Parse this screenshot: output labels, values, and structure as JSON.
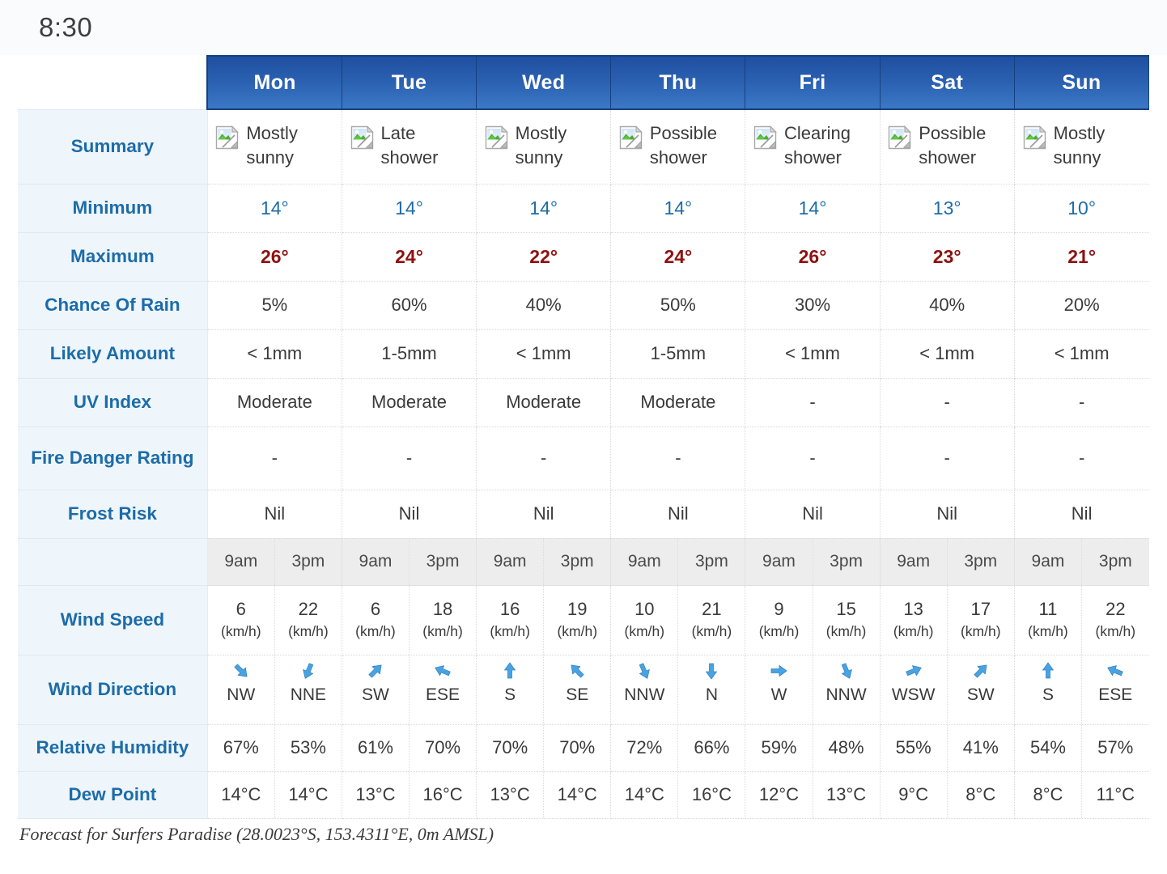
{
  "status_bar": {
    "clock": "8:30"
  },
  "colors": {
    "header_blue_dark": "#1f4fa0",
    "header_blue_light": "#3b78c6",
    "label_text": "#1d6ca8",
    "label_bg": "#eef6fc",
    "min_temp": "#1d6ca8",
    "max_temp": "#8e1111",
    "time_header_bg": "#ededed",
    "arrow_blue": "#4aa3e0"
  },
  "table": {
    "corner_label": "",
    "days": [
      "Mon",
      "Tue",
      "Wed",
      "Thu",
      "Fri",
      "Sat",
      "Sun"
    ],
    "row_labels": {
      "summary": "Summary",
      "minimum": "Minimum",
      "maximum": "Maximum",
      "chance_of_rain": "Chance Of Rain",
      "likely_amount": "Likely Amount",
      "uv_index": "UV Index",
      "fire_danger_rating": "Fire Danger Rating",
      "frost_risk": "Frost Risk",
      "time_blank": "",
      "wind_speed": "Wind Speed",
      "wind_direction": "Wind Direction",
      "relative_humidity": "Relative Humidity",
      "dew_point": "Dew Point"
    },
    "icon_name": "broken-image-icon",
    "summary": [
      "Mostly sunny",
      "Late shower",
      "Mostly sunny",
      "Possible shower",
      "Clearing shower",
      "Possible shower",
      "Mostly sunny"
    ],
    "minimum": [
      "14°",
      "14°",
      "14°",
      "14°",
      "14°",
      "13°",
      "10°"
    ],
    "maximum": [
      "26°",
      "24°",
      "22°",
      "24°",
      "26°",
      "23°",
      "21°"
    ],
    "chance_of_rain": [
      "5%",
      "60%",
      "40%",
      "50%",
      "30%",
      "40%",
      "20%"
    ],
    "likely_amount": [
      "< 1mm",
      "1-5mm",
      "< 1mm",
      "1-5mm",
      "< 1mm",
      "< 1mm",
      "< 1mm"
    ],
    "uv_index": [
      "Moderate",
      "Moderate",
      "Moderate",
      "Moderate",
      "-",
      "-",
      "-"
    ],
    "fire_danger_rating": [
      "-",
      "-",
      "-",
      "-",
      "-",
      "-",
      "-"
    ],
    "frost_risk": [
      "Nil",
      "Nil",
      "Nil",
      "Nil",
      "Nil",
      "Nil",
      "Nil"
    ],
    "times": [
      "9am",
      "3pm",
      "9am",
      "3pm",
      "9am",
      "3pm",
      "9am",
      "3pm",
      "9am",
      "3pm",
      "9am",
      "3pm",
      "9am",
      "3pm"
    ],
    "wind_speed": [
      "6",
      "22",
      "6",
      "18",
      "16",
      "19",
      "10",
      "21",
      "9",
      "15",
      "13",
      "17",
      "11",
      "22"
    ],
    "wind_speed_unit": "(km/h)",
    "wind_direction": [
      "NW",
      "NNE",
      "SW",
      "ESE",
      "S",
      "SE",
      "NNW",
      "N",
      "W",
      "NNW",
      "WSW",
      "SW",
      "S",
      "ESE"
    ],
    "relative_humidity": [
      "67%",
      "53%",
      "61%",
      "70%",
      "70%",
      "70%",
      "72%",
      "66%",
      "59%",
      "48%",
      "55%",
      "41%",
      "54%",
      "57%"
    ],
    "dew_point": [
      "14°C",
      "14°C",
      "13°C",
      "16°C",
      "13°C",
      "14°C",
      "14°C",
      "16°C",
      "12°C",
      "13°C",
      "9°C",
      "8°C",
      "8°C",
      "11°C"
    ]
  },
  "footer": {
    "text": "Forecast for Surfers Paradise (28.0023°S, 153.4311°E, 0m AMSL)"
  }
}
